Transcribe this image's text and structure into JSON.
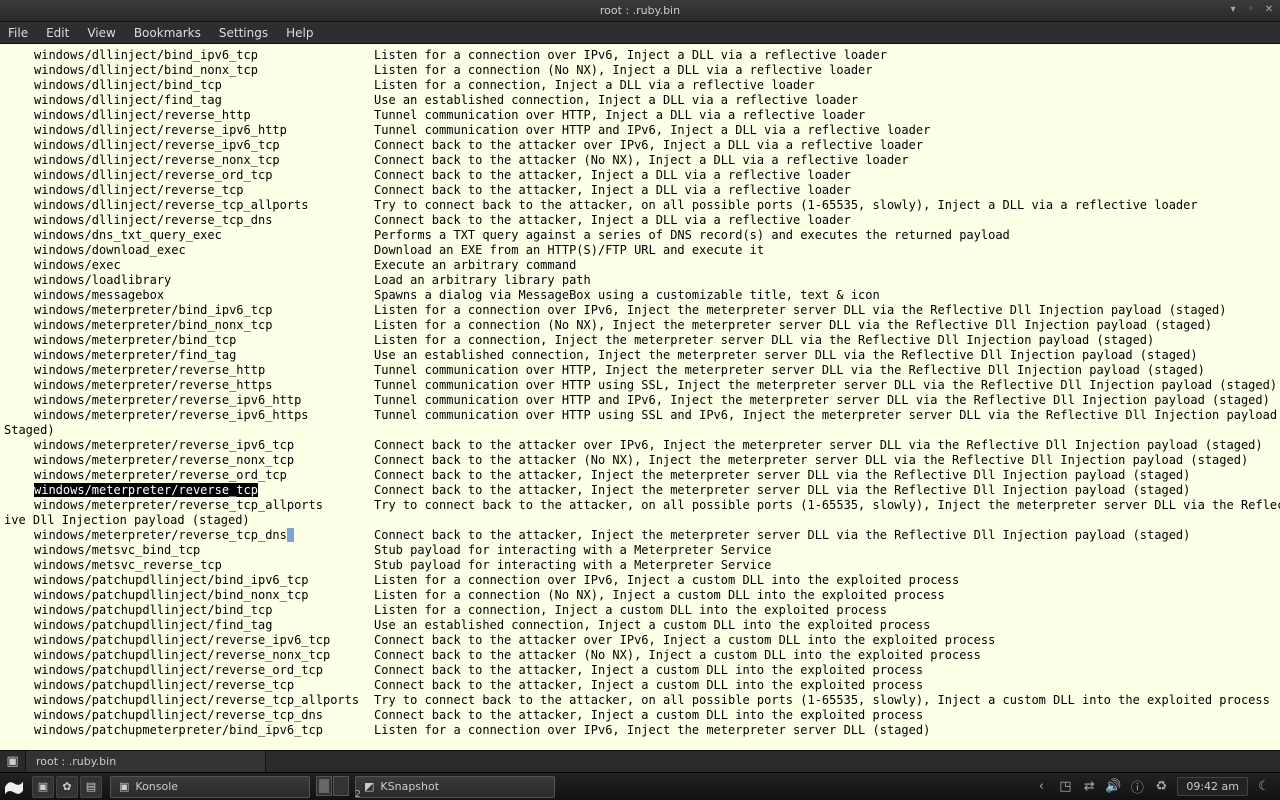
{
  "window": {
    "title": "root : .ruby.bin"
  },
  "menu": {
    "file": "File",
    "edit": "Edit",
    "view": "View",
    "bookmarks": "Bookmarks",
    "settings": "Settings",
    "help": "Help"
  },
  "tab": {
    "label": "root : .ruby.bin"
  },
  "taskbar": {
    "konsole": "Konsole",
    "ksnapshot": "KSnapshot",
    "clock": "09:42 am",
    "pager_count": "2"
  },
  "rows": [
    {
      "name": "windows/dllinject/bind_ipv6_tcp",
      "desc": "Listen for a connection over IPv6, Inject a DLL via a reflective loader"
    },
    {
      "name": "windows/dllinject/bind_nonx_tcp",
      "desc": "Listen for a connection (No NX), Inject a DLL via a reflective loader"
    },
    {
      "name": "windows/dllinject/bind_tcp",
      "desc": "Listen for a connection, Inject a DLL via a reflective loader"
    },
    {
      "name": "windows/dllinject/find_tag",
      "desc": "Use an established connection, Inject a DLL via a reflective loader"
    },
    {
      "name": "windows/dllinject/reverse_http",
      "desc": "Tunnel communication over HTTP, Inject a DLL via a reflective loader"
    },
    {
      "name": "windows/dllinject/reverse_ipv6_http",
      "desc": "Tunnel communication over HTTP and IPv6, Inject a DLL via a reflective loader"
    },
    {
      "name": "windows/dllinject/reverse_ipv6_tcp",
      "desc": "Connect back to the attacker over IPv6, Inject a DLL via a reflective loader"
    },
    {
      "name": "windows/dllinject/reverse_nonx_tcp",
      "desc": "Connect back to the attacker (No NX), Inject a DLL via a reflective loader"
    },
    {
      "name": "windows/dllinject/reverse_ord_tcp",
      "desc": "Connect back to the attacker, Inject a DLL via a reflective loader"
    },
    {
      "name": "windows/dllinject/reverse_tcp",
      "desc": "Connect back to the attacker, Inject a DLL via a reflective loader"
    },
    {
      "name": "windows/dllinject/reverse_tcp_allports",
      "desc": "Try to connect back to the attacker, on all possible ports (1-65535, slowly), Inject a DLL via a reflective loader"
    },
    {
      "name": "windows/dllinject/reverse_tcp_dns",
      "desc": "Connect back to the attacker, Inject a DLL via a reflective loader"
    },
    {
      "name": "windows/dns_txt_query_exec",
      "desc": "Performs a TXT query against a series of DNS record(s) and executes the returned payload"
    },
    {
      "name": "windows/download_exec",
      "desc": "Download an EXE from an HTTP(S)/FTP URL and execute it"
    },
    {
      "name": "windows/exec",
      "desc": "Execute an arbitrary command"
    },
    {
      "name": "windows/loadlibrary",
      "desc": "Load an arbitrary library path"
    },
    {
      "name": "windows/messagebox",
      "desc": "Spawns a dialog via MessageBox using a customizable title, text & icon"
    },
    {
      "name": "windows/meterpreter/bind_ipv6_tcp",
      "desc": "Listen for a connection over IPv6, Inject the meterpreter server DLL via the Reflective Dll Injection payload (staged)"
    },
    {
      "name": "windows/meterpreter/bind_nonx_tcp",
      "desc": "Listen for a connection (No NX), Inject the meterpreter server DLL via the Reflective Dll Injection payload (staged)"
    },
    {
      "name": "windows/meterpreter/bind_tcp",
      "desc": "Listen for a connection, Inject the meterpreter server DLL via the Reflective Dll Injection payload (staged)"
    },
    {
      "name": "windows/meterpreter/find_tag",
      "desc": "Use an established connection, Inject the meterpreter server DLL via the Reflective Dll Injection payload (staged)"
    },
    {
      "name": "windows/meterpreter/reverse_http",
      "desc": "Tunnel communication over HTTP, Inject the meterpreter server DLL via the Reflective Dll Injection payload (staged)"
    },
    {
      "name": "windows/meterpreter/reverse_https",
      "desc": "Tunnel communication over HTTP using SSL, Inject the meterpreter server DLL via the Reflective Dll Injection payload (staged)"
    },
    {
      "name": "windows/meterpreter/reverse_ipv6_http",
      "desc": "Tunnel communication over HTTP and IPv6, Inject the meterpreter server DLL via the Reflective Dll Injection payload (staged)"
    },
    {
      "name": "windows/meterpreter/reverse_ipv6_https",
      "desc": "Tunnel communication over HTTP using SSL and IPv6, Inject the meterpreter server DLL via the Reflective Dll Injection payload (",
      "wrap": "Staged)"
    },
    {
      "name": "windows/meterpreter/reverse_ipv6_tcp",
      "desc": "Connect back to the attacker over IPv6, Inject the meterpreter server DLL via the Reflective Dll Injection payload (staged)"
    },
    {
      "name": "windows/meterpreter/reverse_nonx_tcp",
      "desc": "Connect back to the attacker (No NX), Inject the meterpreter server DLL via the Reflective Dll Injection payload (staged)"
    },
    {
      "name": "windows/meterpreter/reverse_ord_tcp",
      "desc": "Connect back to the attacker, Inject the meterpreter server DLL via the Reflective Dll Injection payload (staged)"
    },
    {
      "name": "windows/meterpreter/reverse_tcp",
      "desc": "Connect back to the attacker, Inject the meterpreter server DLL via the Reflective Dll Injection payload (staged)",
      "hl": true
    },
    {
      "name": "windows/meterpreter/reverse_tcp_allports",
      "desc": "Try to connect back to the attacker, on all possible ports (1-65535, slowly), Inject the meterpreter server DLL via the Reflect",
      "wrap": "ive Dll Injection payload (staged)"
    },
    {
      "name": "windows/meterpreter/reverse_tcp_dns",
      "desc": "Connect back to the attacker, Inject the meterpreter server DLL via the Reflective Dll Injection payload (staged)",
      "sel": true
    },
    {
      "name": "windows/metsvc_bind_tcp",
      "desc": "Stub payload for interacting with a Meterpreter Service"
    },
    {
      "name": "windows/metsvc_reverse_tcp",
      "desc": "Stub payload for interacting with a Meterpreter Service"
    },
    {
      "name": "windows/patchupdllinject/bind_ipv6_tcp",
      "desc": "Listen for a connection over IPv6, Inject a custom DLL into the exploited process"
    },
    {
      "name": "windows/patchupdllinject/bind_nonx_tcp",
      "desc": "Listen for a connection (No NX), Inject a custom DLL into the exploited process"
    },
    {
      "name": "windows/patchupdllinject/bind_tcp",
      "desc": "Listen for a connection, Inject a custom DLL into the exploited process"
    },
    {
      "name": "windows/patchupdllinject/find_tag",
      "desc": "Use an established connection, Inject a custom DLL into the exploited process"
    },
    {
      "name": "windows/patchupdllinject/reverse_ipv6_tcp",
      "desc": "Connect back to the attacker over IPv6, Inject a custom DLL into the exploited process"
    },
    {
      "name": "windows/patchupdllinject/reverse_nonx_tcp",
      "desc": "Connect back to the attacker (No NX), Inject a custom DLL into the exploited process"
    },
    {
      "name": "windows/patchupdllinject/reverse_ord_tcp",
      "desc": "Connect back to the attacker, Inject a custom DLL into the exploited process"
    },
    {
      "name": "windows/patchupdllinject/reverse_tcp",
      "desc": "Connect back to the attacker, Inject a custom DLL into the exploited process"
    },
    {
      "name": "windows/patchupdllinject/reverse_tcp_allports",
      "desc": "Try to connect back to the attacker, on all possible ports (1-65535, slowly), Inject a custom DLL into the exploited process"
    },
    {
      "name": "windows/patchupdllinject/reverse_tcp_dns",
      "desc": "Connect back to the attacker, Inject a custom DLL into the exploited process"
    },
    {
      "name": "windows/patchupmeterpreter/bind_ipv6_tcp",
      "desc": "Listen for a connection over IPv6, Inject the meterpreter server DLL (staged)"
    }
  ]
}
